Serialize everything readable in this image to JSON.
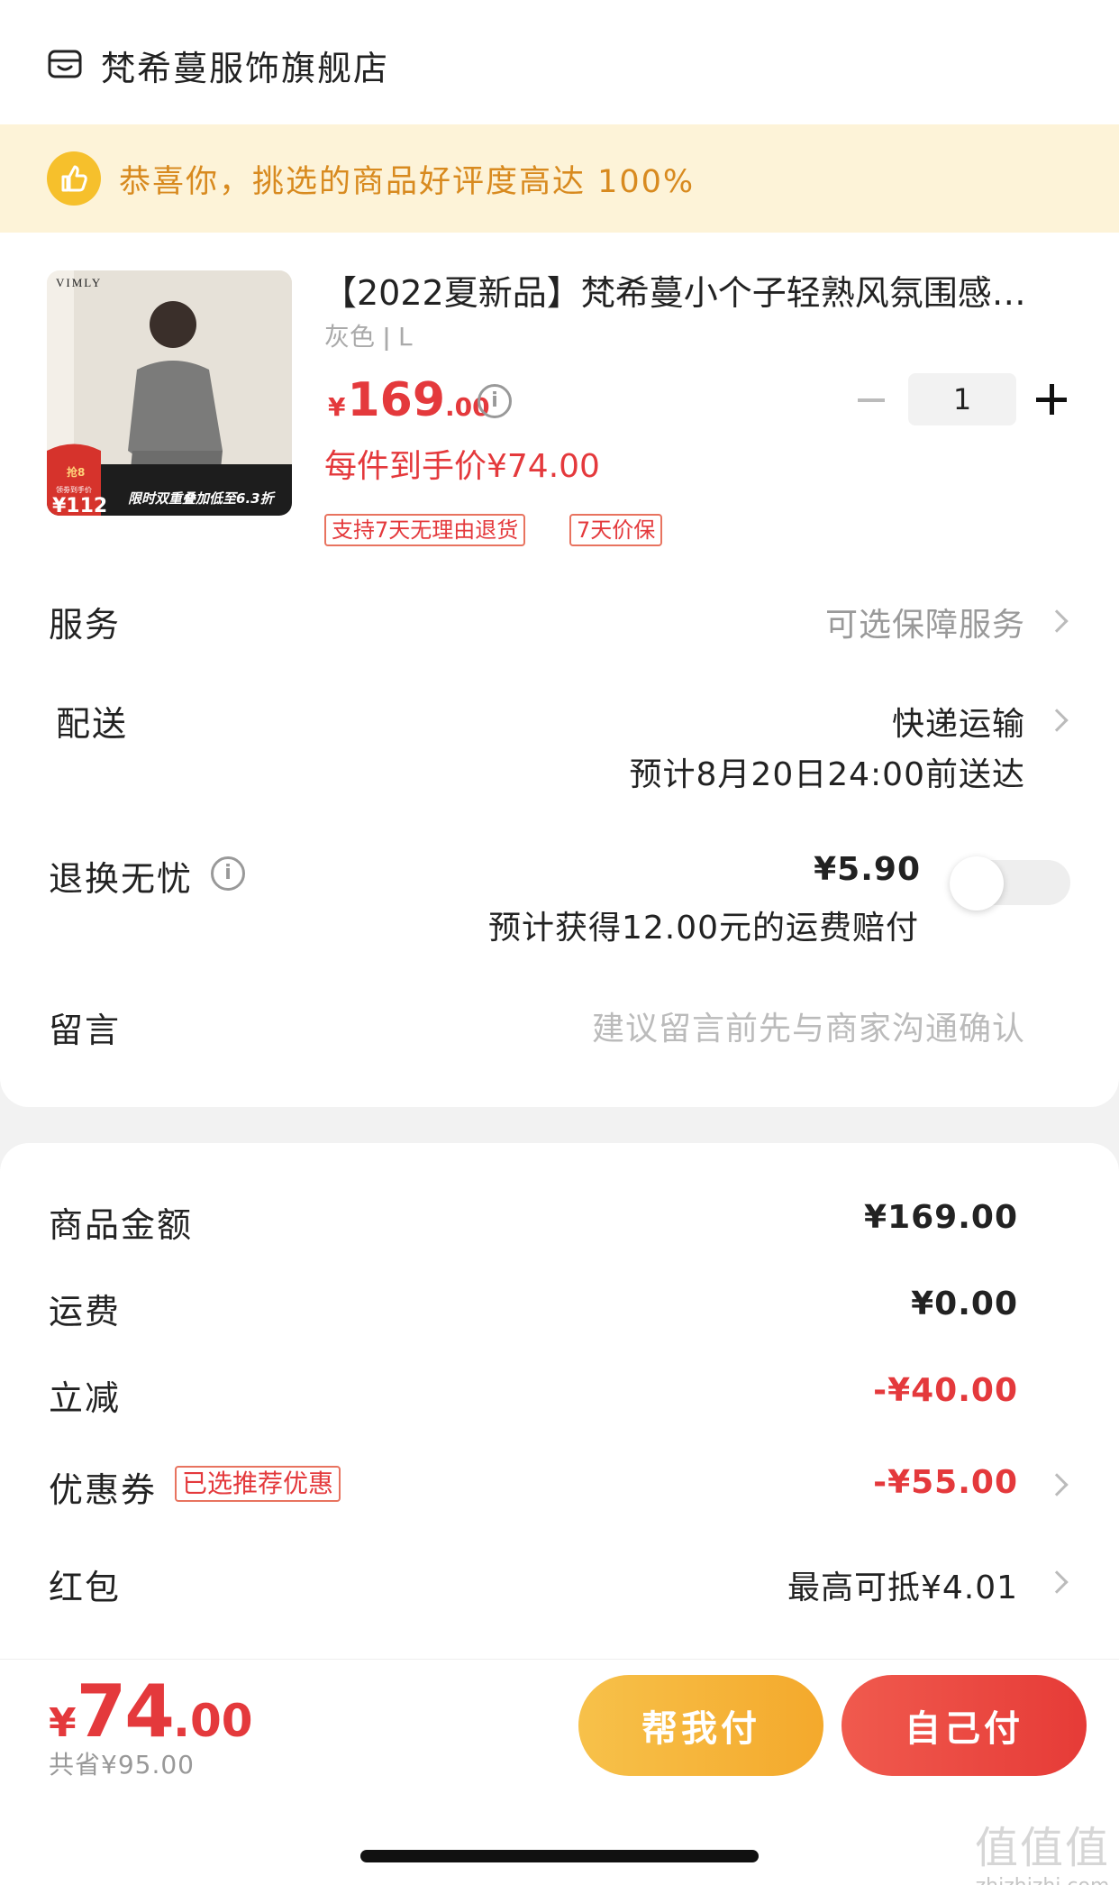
{
  "store": {
    "name": "梵希蔓服饰旗舰店",
    "icon": "store-icon"
  },
  "banner": {
    "text": "恭喜你，挑选的商品好评度高达 100%",
    "icon": "thumbs-up-icon",
    "color": "#d88a1f"
  },
  "product": {
    "title": "【2022夏新品】梵希蔓小个子轻熟风氛围感…",
    "spec": "灰色 ǀ L",
    "price_symbol": "¥",
    "price_int": "169",
    "price_dec": ".00",
    "quantity": "1",
    "promo_price": "每件到手价¥74.00",
    "tags": [
      "支持7天无理由退货",
      "7天价保"
    ],
    "image": {
      "brand": "VIMLY",
      "badge_price": "¥112",
      "badge_top": "抢8",
      "badge_caption": "领劵到手价",
      "banner_text": "限时双重叠加低至6.3折"
    }
  },
  "rows": {
    "service": {
      "label": "服务",
      "value": "可选保障服务"
    },
    "delivery": {
      "label": "配送",
      "value": "快递运输",
      "eta": "预计8月20日24:00前送达"
    },
    "return": {
      "label": "退换无忧",
      "price": "¥5.90",
      "note": "预计获得12.00元的运费赔付",
      "toggle_on": false
    },
    "message": {
      "label": "留言",
      "placeholder": "建议留言前先与商家沟通确认"
    }
  },
  "summary": {
    "goods": {
      "label": "商品金额",
      "value": "¥169.00"
    },
    "shipping": {
      "label": "运费",
      "value": "¥0.00"
    },
    "discount": {
      "label": "立减",
      "value": "-¥40.00"
    },
    "coupon": {
      "label": "优惠券",
      "tag": "已选推荐优惠",
      "value": "-¥55.00"
    },
    "redpacket": {
      "label": "红包",
      "value": "最高可抵¥4.01"
    }
  },
  "footer": {
    "total_symbol": "¥",
    "total_int": "74",
    "total_dec": ".00",
    "saved": "共省¥95.00",
    "help_pay": "帮我付",
    "self_pay": "自己付"
  },
  "watermark": {
    "top": "值值值",
    "bottom": "zhizhizhi.com"
  },
  "colors": {
    "accent_red": "#e4393c",
    "banner_bg": "#fdf3d8",
    "yellow_btn": "#f6b63a",
    "red_btn": "#eb4a42"
  }
}
